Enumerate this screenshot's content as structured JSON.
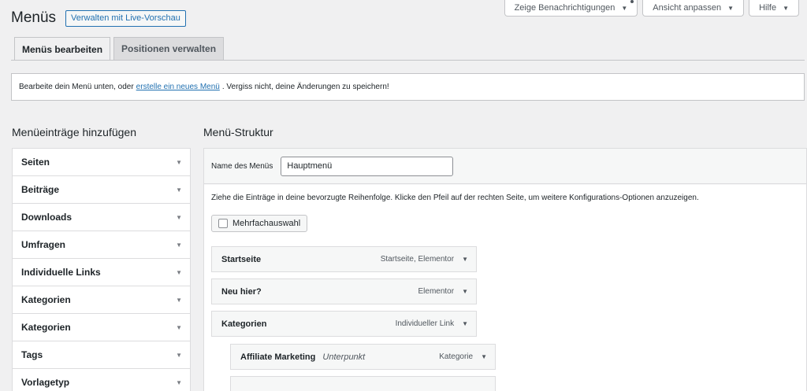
{
  "header": {
    "title": "Menüs",
    "live_preview_label": "Verwalten mit Live-Vorschau"
  },
  "screen_meta": {
    "notifications_label": "Zeige Benachrichtigungen",
    "screen_options_label": "Ansicht anpassen",
    "help_label": "Hilfe"
  },
  "tabs": [
    {
      "label": "Menüs bearbeiten",
      "active": true
    },
    {
      "label": "Positionen verwalten",
      "active": false
    }
  ],
  "notice": {
    "text_before": "Bearbeite dein Menü unten, oder",
    "link": "erstelle ein neues Menü",
    "text_after": ". Vergiss nicht, deine Änderungen zu speichern!"
  },
  "add_items": {
    "title": "Menüeinträge hinzufügen",
    "sections": [
      "Seiten",
      "Beiträge",
      "Downloads",
      "Umfragen",
      "Individuelle Links",
      "Kategorien",
      "Kategorien",
      "Tags",
      "Vorlagetyp"
    ]
  },
  "structure": {
    "title": "Menü-Struktur",
    "menu_name_label": "Name des Menüs",
    "menu_name_value": "Hauptmenü",
    "instructions": "Ziehe die Einträge in deine bevorzugte Reihenfolge. Klicke den Pfeil auf der rechten Seite, um weitere Konfigurations-Optionen anzuzeigen.",
    "bulk_select_label": "Mehrfachauswahl",
    "items": [
      {
        "title": "Startseite",
        "subtitle": "",
        "type": "Startseite, Elementor"
      },
      {
        "title": "Neu hier?",
        "subtitle": "",
        "type": "Elementor"
      },
      {
        "title": "Kategorien",
        "subtitle": "",
        "type": "Individueller Link"
      },
      {
        "title": "Affiliate Marketing",
        "subtitle": "Unterpunkt",
        "type": "Kategorie"
      }
    ]
  },
  "colors": {
    "accent": "#2271b1",
    "background": "#f0f0f1",
    "border": "#c3c4c7"
  }
}
